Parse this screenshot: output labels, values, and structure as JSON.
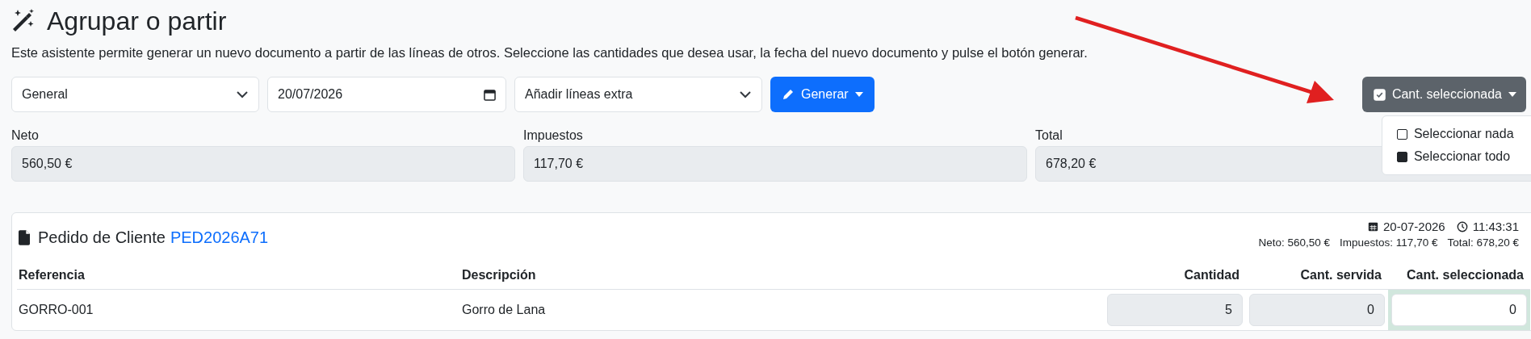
{
  "page": {
    "title": "Agrupar o partir",
    "description": "Este asistente permite generar un nuevo documento a partir de las líneas de otros. Seleccione las cantidades que desea usar, la fecha del nuevo documento y pulse el botón generar."
  },
  "toolbar": {
    "series": {
      "value": "General"
    },
    "date": {
      "value": "20/07/2026"
    },
    "extra_lines": {
      "value": "Añadir líneas extra"
    },
    "generate_button": {
      "label": "Generar"
    },
    "selection_button": {
      "label": "Cant. seleccionada",
      "checked": true
    }
  },
  "selection_menu": {
    "open": true,
    "items": [
      {
        "label": "Seleccionar nada",
        "checked": false
      },
      {
        "label": "Seleccionar todo",
        "checked": true
      }
    ]
  },
  "totals": [
    {
      "label": "Neto",
      "value": "560,50 €"
    },
    {
      "label": "Impuestos",
      "value": "117,70 €"
    },
    {
      "label": "Total",
      "value": "678,20 €"
    }
  ],
  "document": {
    "type_label": "Pedido de Cliente",
    "code": "PED2026A71",
    "date": "20-07-2026",
    "time": "11:43:31",
    "summary": [
      "Neto: 560,50 €",
      "Impuestos: 117,70 €",
      "Total: 678,20 €"
    ],
    "columns": [
      "Referencia",
      "Descripción",
      "Cantidad",
      "Cant. servida",
      "Cant. seleccionada"
    ],
    "rows": [
      {
        "reference": "GORRO-001",
        "description": "Gorro de Lana",
        "quantity": "5",
        "served": "0",
        "selected_quantity": "0"
      }
    ]
  }
}
